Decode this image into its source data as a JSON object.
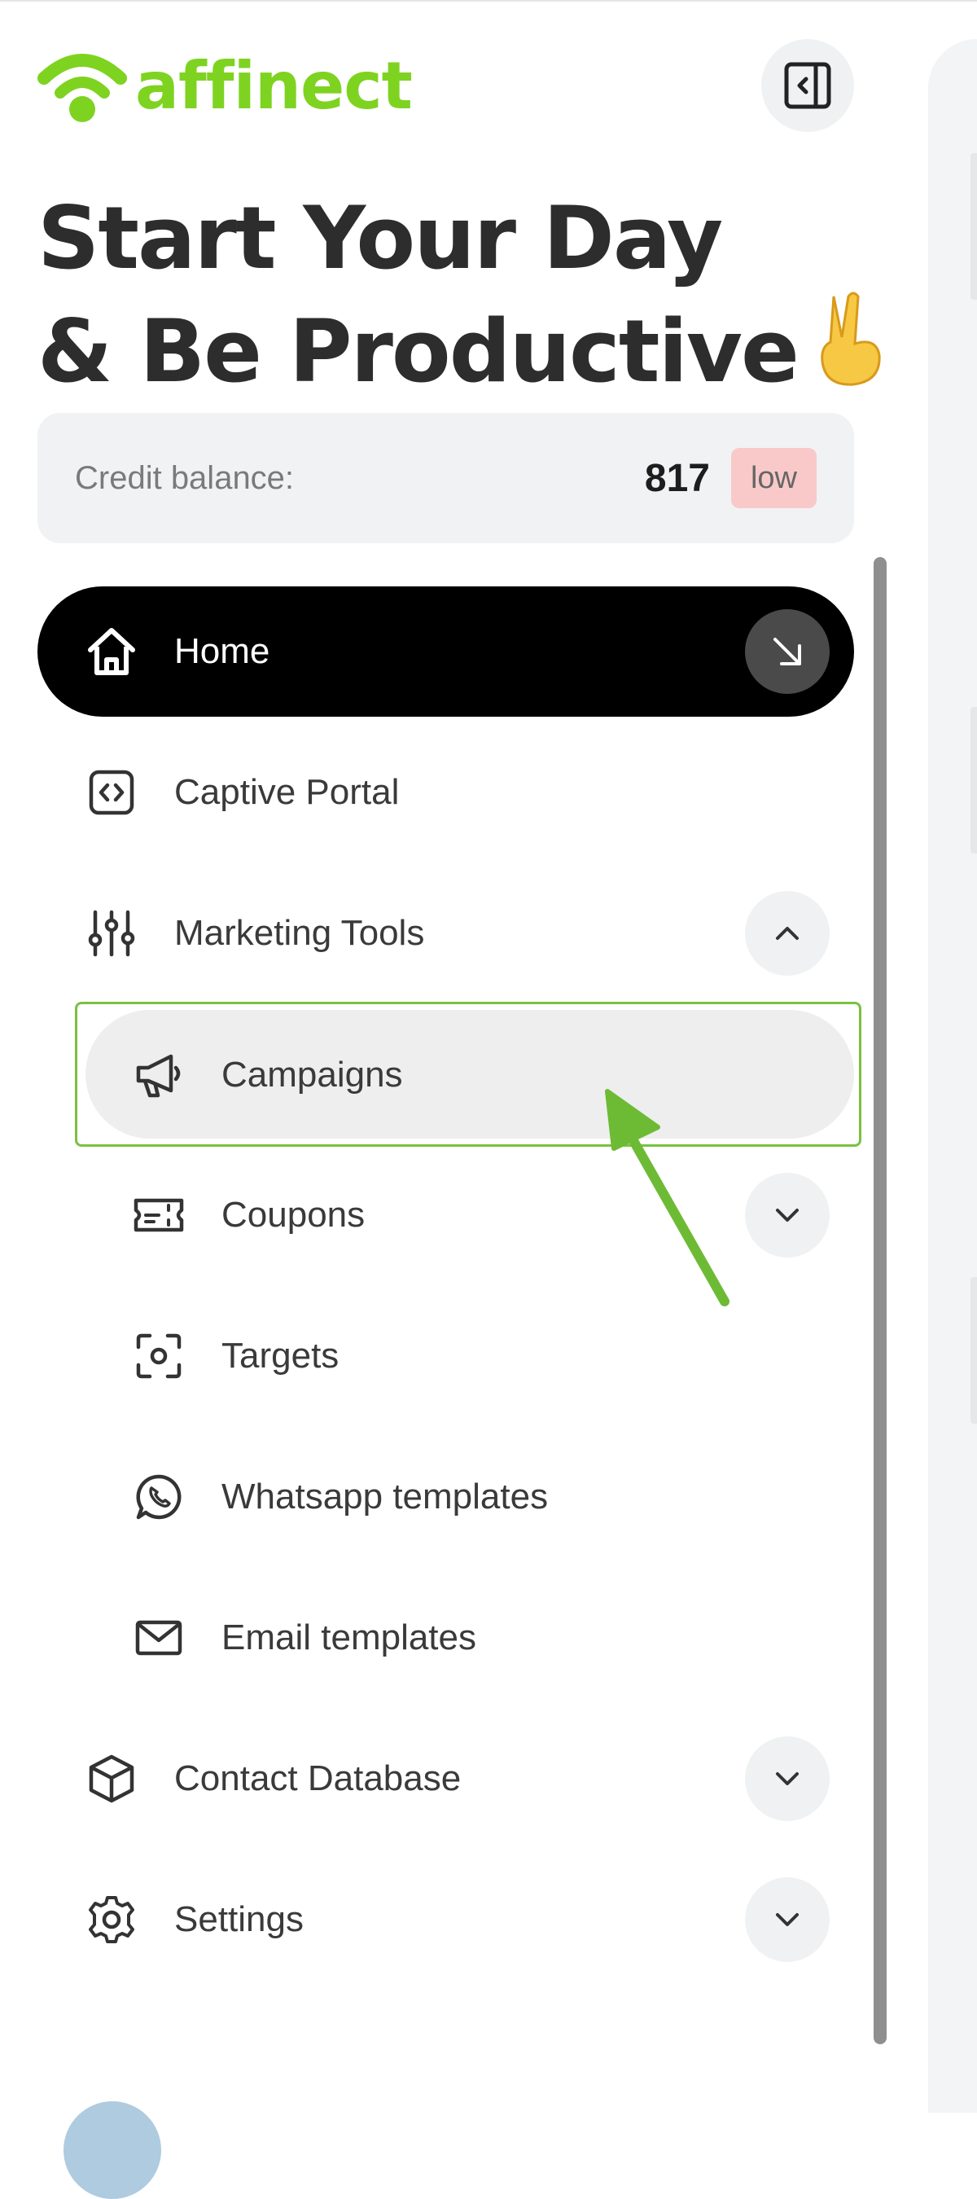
{
  "brand": {
    "name": "affinect",
    "color": "#7ed321"
  },
  "header": {
    "collapse_icon": "sidebar-collapse-icon"
  },
  "greeting": {
    "line1": "Start Your Day",
    "line2": "& Be Productive",
    "emoji": "✌️"
  },
  "credit": {
    "label": "Credit balance:",
    "value": "817",
    "badge": "low",
    "badge_color": "#f9c9c9"
  },
  "nav": {
    "home": {
      "label": "Home",
      "icon": "home-icon"
    },
    "captive_portal": {
      "label": "Captive Portal",
      "icon": "code-icon"
    },
    "marketing_tools": {
      "label": "Marketing Tools",
      "icon": "sliders-icon",
      "expanded": true
    },
    "campaigns": {
      "label": "Campaigns",
      "icon": "megaphone-icon",
      "selected": true
    },
    "coupons": {
      "label": "Coupons",
      "icon": "ticket-icon"
    },
    "targets": {
      "label": "Targets",
      "icon": "target-icon"
    },
    "whatsapp_templates": {
      "label": "Whatsapp templates",
      "icon": "whatsapp-icon"
    },
    "email_templates": {
      "label": "Email templates",
      "icon": "mail-icon"
    },
    "contact_database": {
      "label": "Contact Database",
      "icon": "cube-icon"
    },
    "settings": {
      "label": "Settings",
      "icon": "gear-icon"
    }
  },
  "annotation": {
    "color": "#7ac142",
    "icon": "arrow-pointer-icon"
  }
}
